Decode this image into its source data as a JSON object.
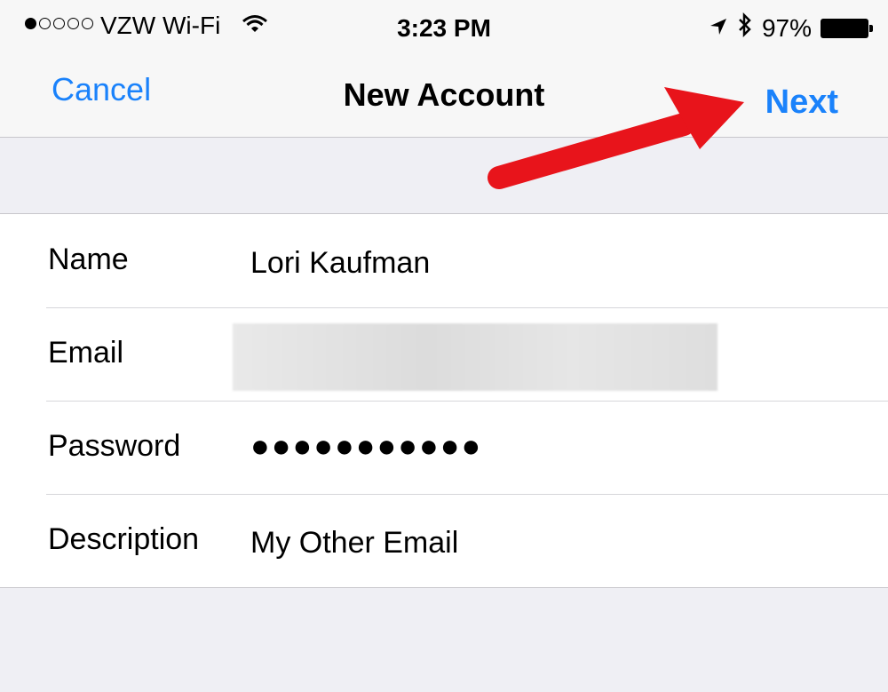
{
  "status_bar": {
    "carrier": "VZW Wi-Fi",
    "time": "3:23 PM",
    "battery_percent": "97%",
    "signal_bars_filled": 1,
    "signal_bars_total": 5
  },
  "nav": {
    "cancel_label": "Cancel",
    "title": "New Account",
    "next_label": "Next"
  },
  "form": {
    "fields": [
      {
        "label": "Name",
        "value": "Lori Kaufman"
      },
      {
        "label": "Email",
        "value": ""
      },
      {
        "label": "Password",
        "value": "●●●●●●●●●●●"
      },
      {
        "label": "Description",
        "value": "My Other Email"
      }
    ]
  },
  "colors": {
    "accent": "#1a82fb",
    "annotation_arrow": "#e8141b"
  }
}
